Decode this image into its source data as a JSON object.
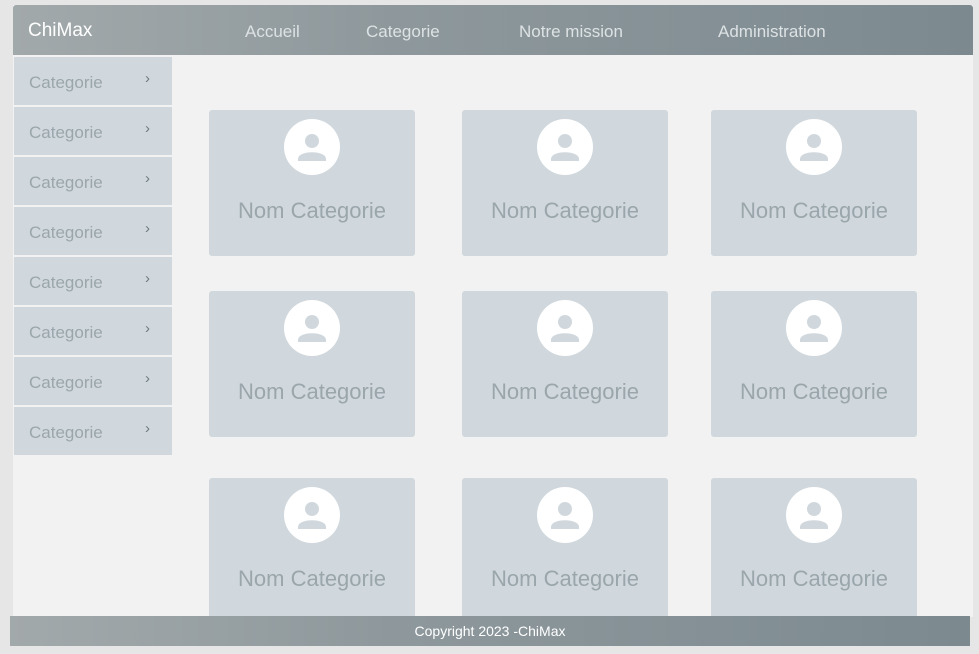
{
  "navbar": {
    "brand": "ChiMax",
    "links": [
      "Accueil",
      "Categorie",
      "Notre mission",
      "Administration"
    ]
  },
  "sidebar": {
    "items": [
      {
        "label": "Categorie",
        "chevron": "›"
      },
      {
        "label": "Categorie",
        "chevron": "›"
      },
      {
        "label": "Categorie",
        "chevron": "›"
      },
      {
        "label": "Categorie",
        "chevron": "›"
      },
      {
        "label": "Categorie",
        "chevron": "›"
      },
      {
        "label": "Categorie",
        "chevron": "›"
      },
      {
        "label": "Categorie",
        "chevron": "›"
      },
      {
        "label": "Categorie",
        "chevron": "›"
      }
    ]
  },
  "cards": [
    {
      "title": "Nom Categorie",
      "icon": "user-icon"
    },
    {
      "title": "Nom Categorie",
      "icon": "user-icon"
    },
    {
      "title": "Nom Categorie",
      "icon": "user-icon"
    },
    {
      "title": "Nom Categorie",
      "icon": "user-icon"
    },
    {
      "title": "Nom Categorie",
      "icon": "user-icon"
    },
    {
      "title": "Nom Categorie",
      "icon": "user-icon"
    },
    {
      "title": "Nom Categorie",
      "icon": "user-icon"
    },
    {
      "title": "Nom Categorie",
      "icon": "user-icon"
    },
    {
      "title": "Nom Categorie",
      "icon": "user-icon"
    }
  ],
  "footer": {
    "text": "Copyright 2023 -ChiMax"
  },
  "colors": {
    "navbar_start": "#a2a9ab",
    "navbar_end": "#7c8a90",
    "card_bg": "#d0d8dd",
    "text_muted": "#9aa6ab",
    "page_bg": "#f2f2f2"
  }
}
